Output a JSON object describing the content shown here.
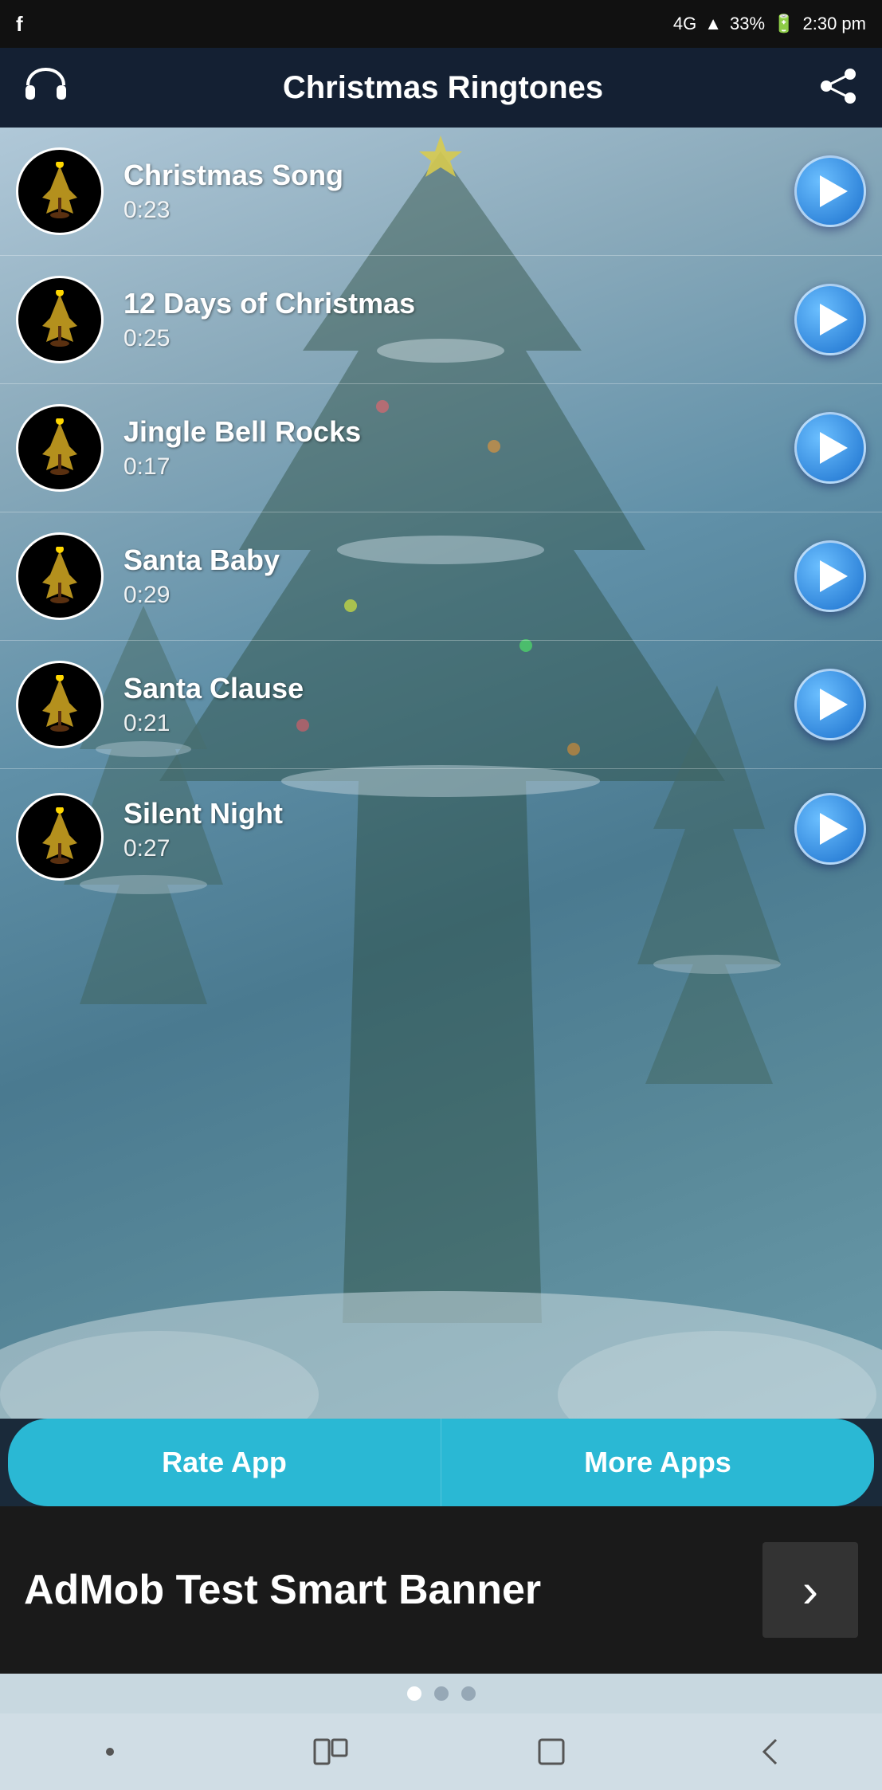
{
  "statusBar": {
    "network": "4G",
    "signal": "▲",
    "battery": "33%",
    "time": "2:30 pm",
    "facebookIcon": "f"
  },
  "header": {
    "title": "Christmas Ringtones",
    "headphonesIcon": "headphones",
    "shareIcon": "share"
  },
  "songs": [
    {
      "name": "Christmas Song",
      "duration": "0:23"
    },
    {
      "name": "12 Days of Christmas",
      "duration": "0:25"
    },
    {
      "name": "Jingle Bell Rocks",
      "duration": "0:17"
    },
    {
      "name": "Santa Baby",
      "duration": "0:29"
    },
    {
      "name": "Santa Clause",
      "duration": "0:21"
    },
    {
      "name": "Silent Night",
      "duration": "0:27"
    }
  ],
  "buttons": {
    "rateApp": "Rate App",
    "moreApps": "More Apps"
  },
  "ad": {
    "text": "AdMob Test Smart Banner"
  },
  "dots": [
    {
      "active": true
    },
    {
      "active": false
    },
    {
      "active": false
    }
  ]
}
